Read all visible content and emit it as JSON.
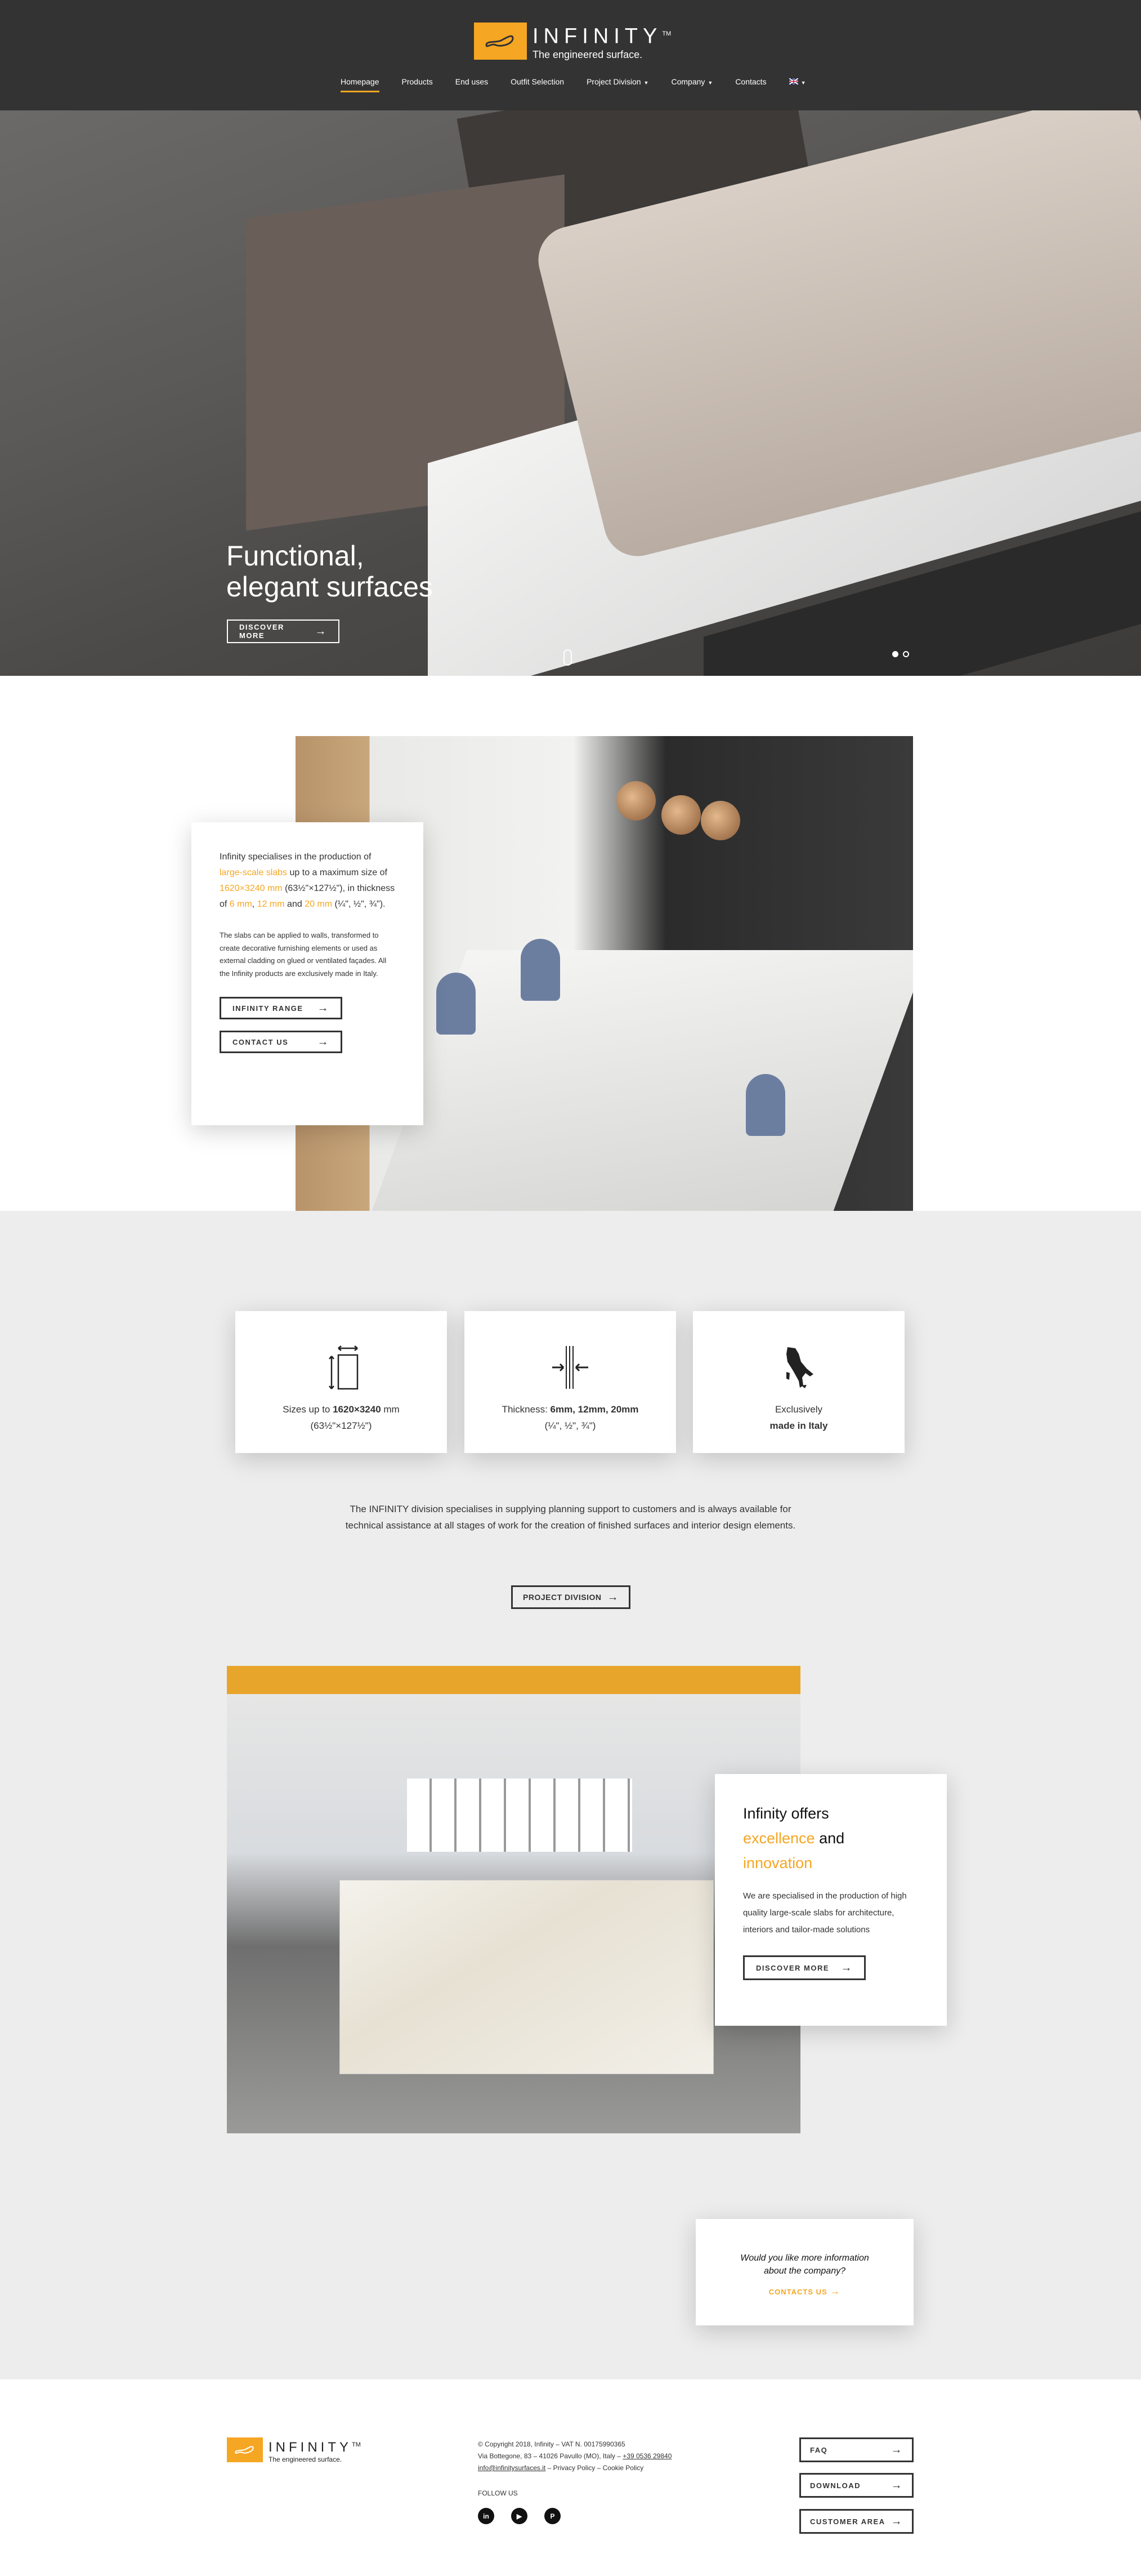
{
  "brand": {
    "name": "INFINITY",
    "tm": "TM",
    "tagline": "The engineered surface.",
    "accent": "#f5a623"
  },
  "nav": {
    "items": [
      {
        "label": "Homepage",
        "active": true
      },
      {
        "label": "Products"
      },
      {
        "label": "End uses"
      },
      {
        "label": "Outfit Selection"
      },
      {
        "label": "Project Division",
        "dropdown": true
      },
      {
        "label": "Company",
        "dropdown": true
      },
      {
        "label": "Contacts"
      }
    ],
    "language_icon": "uk-flag-icon"
  },
  "hero": {
    "title_line1": "Functional,",
    "title_line2": "elegant surfaces",
    "button": "DISCOVER MORE",
    "slides": 2,
    "active_slide": 1
  },
  "intro": {
    "p1_a": "Infinity specialises in the production of ",
    "p1_hl1": "large-scale slabs",
    "p1_b": " up to a maximum size of ",
    "p1_hl2": "1620×3240 mm",
    "p1_c": " (63½\"×127½\"), in thickness of ",
    "p1_hl3": "6 mm",
    "p1_d": ", ",
    "p1_hl4": "12 mm",
    "p1_e": " and ",
    "p1_hl5": "20 mm",
    "p1_f": " (¼\", ½\", ¾\").",
    "p2": "The slabs can be applied to walls, transformed to create decorative furnishing elements or used as external cladding on glued or ventilated façades. All the Infinity products are exclusively made in Italy.",
    "btn_range": "INFINITY RANGE",
    "btn_contact": "CONTACT US"
  },
  "features": [
    {
      "icon": "size-icon",
      "a": "Sizes up to ",
      "b": "1620×3240",
      "c": " mm",
      "line2": "(63½\"×127½\")"
    },
    {
      "icon": "thickness-icon",
      "a": "Thickness: ",
      "b": "6mm, 12mm, 20mm",
      "c": "",
      "line2": "(¼\", ½\", ¾\")"
    },
    {
      "icon": "italy-map-icon",
      "a": "Exclusively",
      "b": "",
      "c": "",
      "line2": "made in Italy"
    }
  ],
  "division": {
    "text": "The INFINITY division specialises in supplying planning support to customers and is always available for technical assistance at all stages of work for the creation of finished surfaces and interior design elements.",
    "button": "PROJECT DIVISION"
  },
  "offer": {
    "t1": "Infinity offers",
    "t2": "excellence",
    "t3": " and",
    "t4": "innovation",
    "text": "We are specialised in the production of high quality large-scale slabs for architecture, interiors and tailor-made solutions",
    "button": "DISCOVER MORE"
  },
  "more": {
    "question": "Would you like more information about the company?",
    "link": "CONTACTS US"
  },
  "footer": {
    "copyright": "© Copyright 2018, Infinity – VAT N. 00175990365",
    "address": "Via Bottegone, 83 – 41026 Pavullo (MO), Italy – ",
    "phone": "+39 0536 29840",
    "email": "info@infinitysurfaces.it",
    "sep": " – ",
    "privacy": "Privacy Policy",
    "cookie": "Cookie Policy",
    "follow": "FOLLOW US",
    "social": [
      {
        "icon": "linkedin-icon",
        "glyph": "in"
      },
      {
        "icon": "youtube-icon",
        "glyph": "▶"
      },
      {
        "icon": "pinterest-icon",
        "glyph": "P"
      }
    ],
    "buttons": [
      "FAQ",
      "DOWNLOAD",
      "CUSTOMER AREA"
    ]
  }
}
